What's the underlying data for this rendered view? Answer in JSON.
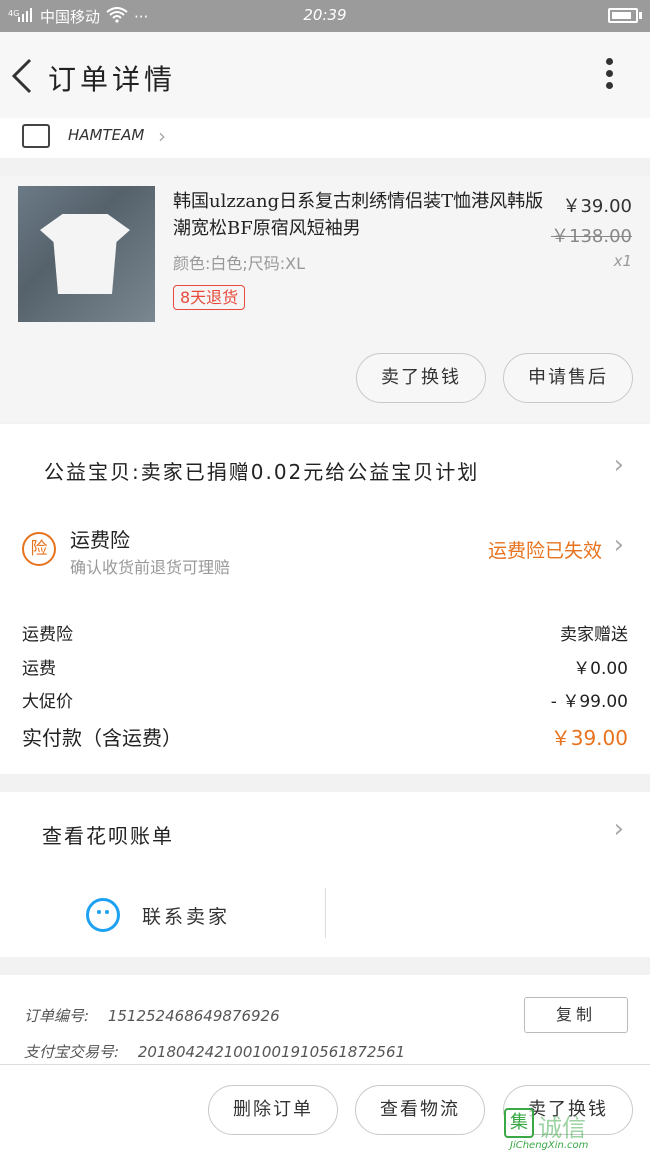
{
  "status_bar": {
    "carrier": "中国移动",
    "signal_icon": "signal-icon",
    "wifi_icon": "wifi-icon",
    "more": "···",
    "time": "20:39",
    "battery_icon": "battery-icon"
  },
  "header": {
    "title": "订单详情",
    "back_icon": "back-arrow-icon",
    "more_icon": "more-vertical-icon"
  },
  "shop": {
    "name": "HAMTEAM",
    "icon": "store-icon"
  },
  "product": {
    "title": "韩国ulzzang日系复古刺绣情侣装T恤港风韩版潮宽松BF原宿风短袖男",
    "price": "￥39.00",
    "original_price": "￥138.00",
    "quantity": "x1",
    "spec": "颜色:白色;尺码:XL",
    "return_tag": "8天退货",
    "actions": [
      "卖了换钱",
      "申请售后"
    ]
  },
  "charity": {
    "text": "公益宝贝:卖家已捐赠0.02元给公益宝贝计划"
  },
  "insurance": {
    "icon_char": "险",
    "title": "运费险",
    "subtitle": "确认收货前退货可理赔",
    "status": "运费险已失效",
    "accent_color": "#e8731e"
  },
  "fees": [
    {
      "label": "运费险",
      "value": "卖家赠送"
    },
    {
      "label": "运费",
      "value": "￥0.00"
    },
    {
      "label": "大促价",
      "value": "- ￥99.00"
    }
  ],
  "total": {
    "label": "实付款（含运费）",
    "value": "￥39.00"
  },
  "huabei": {
    "label": "查看花呗账单"
  },
  "contact": {
    "label": "联系卖家",
    "icon": "chat-smile-icon",
    "color": "#1da1f2"
  },
  "order": {
    "number_label": "订单编号:",
    "number": "151252468649876926",
    "trade_label": "支付宝交易号:",
    "trade_number": "2018042421001001910561872561",
    "copy_label": "复制"
  },
  "bottom_actions": [
    "删除订单",
    "查看物流",
    "卖了换钱"
  ],
  "watermark": {
    "cn": "诚信",
    "en": "JiChengXin.com",
    "logo_char": "集"
  }
}
